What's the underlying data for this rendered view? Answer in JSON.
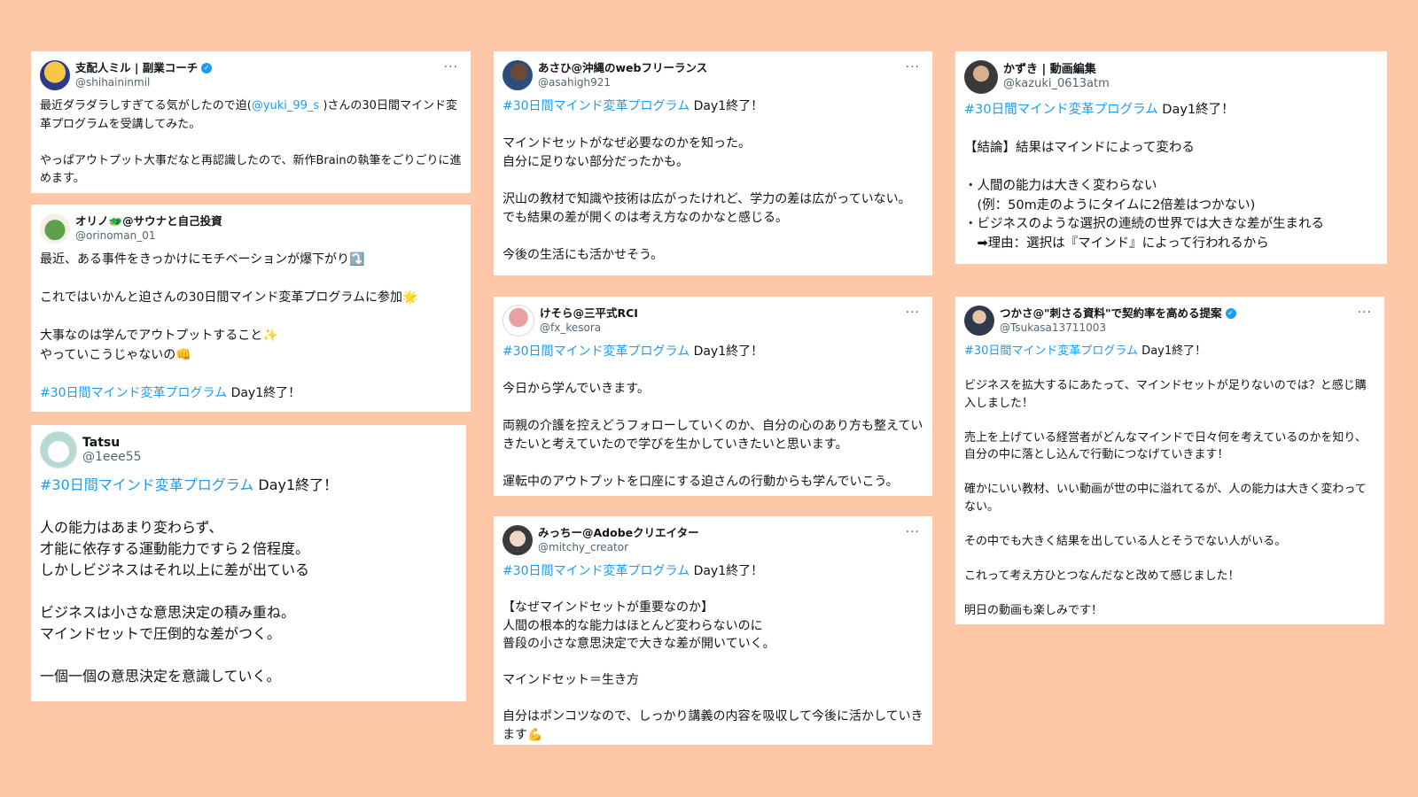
{
  "colors": {
    "background": "#fec7a8",
    "link": "#1d9bf0",
    "verified": "#1d9bf0"
  },
  "more_icon": "···",
  "tweets": [
    {
      "name": "支配人ミル | 副業コーチ",
      "verified": true,
      "handle": "@shihaininmil",
      "l1a": "最近ダラダラしすぎてる気がしたので迫(",
      "mention": "@yuki_99_s",
      "l1b": " )さんの30日間マインド変革プログラムを受講してみた。",
      "l2": "やっぱアウトプット大事だなと再認識したので、新作Brainの執筆をごりごりに進めます。"
    },
    {
      "name": "オリノ🐲@サウナと自己投資",
      "handle": "@orinoman_01",
      "l1": "最近、ある事件をきっかけにモチベーションが爆下がり",
      "l1_emoji": "⤵️",
      "l2": "これではいかんと迫さんの30日間マインド変革プログラムに参加",
      "l2_emoji": "🌟",
      "l3": "大事なのは学んでアウトプットすること",
      "l3_emoji": "✨",
      "l4": "やっていこうじゃないの",
      "l4_emoji": "👊",
      "hashtag": "#30日間マインド変革プログラム",
      "tail": " Day1終了！"
    },
    {
      "name": "Tatsu",
      "handle": "@1eee55",
      "hashtag": "#30日間マインド変革プログラム",
      "tail": " Day1終了！",
      "l1": "人の能力はあまり変わらず、",
      "l2": "才能に依存する運動能力ですら２倍程度。",
      "l3": "しかしビジネスはそれ以上に差が出ている",
      "l4": "ビジネスは小さな意思決定の積み重ね。",
      "l5": "マインドセットで圧倒的な差がつく。",
      "l6": "一個一個の意思決定を意識していく。"
    },
    {
      "name": "あさひ@沖縄のwebフリーランス",
      "handle": "@asahigh921",
      "hashtag": "#30日間マインド変革プログラム",
      "tail": " Day1終了！",
      "l1": "マインドセットがなぜ必要なのかを知った。",
      "l2": "自分に足りない部分だったかも。",
      "l3": "沢山の教材で知識や技術は広がったけれど、学力の差は広がっていない。",
      "l4": "でも結果の差が開くのは考え方なのかなと感じる。",
      "l5": "今後の生活にも活かせそう。"
    },
    {
      "name": "けそら@三平式RCI",
      "handle": "@fx_kesora",
      "hashtag": "#30日間マインド変革プログラム",
      "tail": " Day1終了！",
      "l1": "今日から学んでいきます。",
      "l2": "両親の介護を控えどうフォローしていくのか、自分の心のあり方も整えていきたいと考えていたので学びを生かしていきたいと思います。",
      "l3": "運転中のアウトプットを口座にする迫さんの行動からも学んでいこう。"
    },
    {
      "name": "みっちー@Adobeクリエイター",
      "handle": "@mitchy_creator",
      "hashtag": "#30日間マインド変革プログラム",
      "tail": " Day1終了！",
      "l1": "【なぜマインドセットが重要なのか】",
      "l2": "人間の根本的な能力はほとんど変わらないのに",
      "l3": "普段の小さな意思決定で大きな差が開いていく。",
      "l4": "マインドセット＝生き方",
      "l5": "自分はポンコツなので、しっかり講義の内容を吸収して今後に活かしていきます",
      "l5_emoji": "💪"
    },
    {
      "name": "かずき | 動画編集",
      "handle": "@kazuki_0613atm",
      "hashtag": "#30日間マインド変革プログラム",
      "tail": " Day1終了！",
      "l1": "【結論】結果はマインドによって変わる",
      "l2": "・人間の能力は大きく変わらない",
      "l3": "　(例：50m走のようにタイムに2倍差はつかない)",
      "l4": "・ビジネスのような選択の連続の世界では大きな差が生まれる",
      "l5": "　➡理由：選択は『マインド』によって行われるから"
    },
    {
      "name": "つかさ@\"刺さる資料\"で契約率を高める提案",
      "verified": true,
      "handle": "@Tsukasa13711003",
      "hashtag": "#30日間マインド変革プログラム",
      "tail": " Day1終了！",
      "l1": "ビジネスを拡大するにあたって、マインドセットが足りないのでは？と感じ購入しました！",
      "l2": "売上を上げている経営者がどんなマインドで日々何を考えているのかを知り、自分の中に落とし込んで行動につなげていきます！",
      "l3": "確かにいい教材、いい動画が世の中に溢れてるが、人の能力は大きく変わってない。",
      "l4": "その中でも大きく結果を出している人とそうでない人がいる。",
      "l5": "これって考え方ひとつなんだなと改めて感じました！",
      "l6": "明日の動画も楽しみです！"
    }
  ]
}
